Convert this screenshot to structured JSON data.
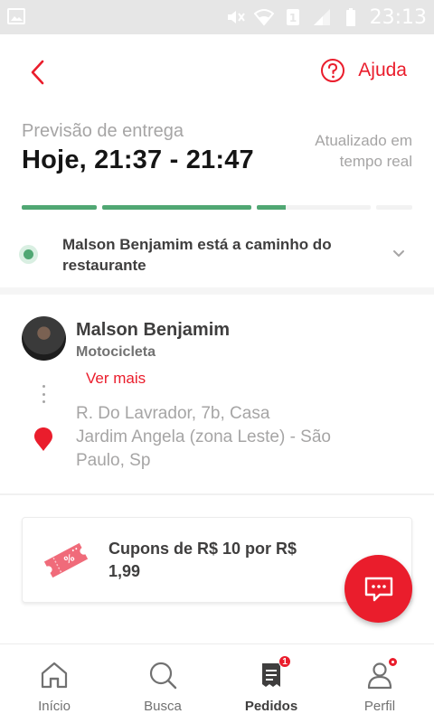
{
  "status_bar": {
    "time": "23:13",
    "icons": [
      "image-icon",
      "mute-icon",
      "wifi-icon",
      "sim-icon",
      "signal-icon",
      "battery-icon"
    ]
  },
  "header": {
    "back_icon": "chevron-left-icon",
    "help_icon": "question-circle-icon",
    "help_label": "Ajuda"
  },
  "delivery": {
    "forecast_label": "Previsão de entrega",
    "forecast_time": "Hoje, 21:37 - 21:47",
    "realtime_line1": "Atualizado em",
    "realtime_line2": "tempo real"
  },
  "progress": {
    "segments": [
      1,
      1,
      0.25,
      0
    ],
    "color": "#50a773"
  },
  "order_status": {
    "text": "Malson Benjamim está a caminho do restaurante",
    "dot_color": "#50a773"
  },
  "courier": {
    "name": "Malson Benjamim",
    "vehicle": "Motocicleta",
    "more_label": "Ver mais",
    "address_line1": "R. Do Lavrador, 7b, Casa",
    "address_line2": "Jardim Angela (zona Leste) - São",
    "address_line3": "Paulo, Sp"
  },
  "coupon": {
    "line1": "Cupons de R$ 10 por R$",
    "line2": "1,99",
    "icon": "coupon-ticket-icon"
  },
  "fab": {
    "icon": "chat-icon"
  },
  "bottom_nav": {
    "items": [
      {
        "label": "Início",
        "icon": "home-icon",
        "active": false
      },
      {
        "label": "Busca",
        "icon": "search-icon",
        "active": false
      },
      {
        "label": "Pedidos",
        "icon": "orders-icon",
        "active": true,
        "badge": "1"
      },
      {
        "label": "Perfil",
        "icon": "profile-icon",
        "active": false,
        "dot": true
      }
    ]
  },
  "colors": {
    "accent": "#ea1d2c",
    "success": "#50a773",
    "text_dark": "#3f3e3e",
    "text_muted": "#a6a5a5"
  }
}
